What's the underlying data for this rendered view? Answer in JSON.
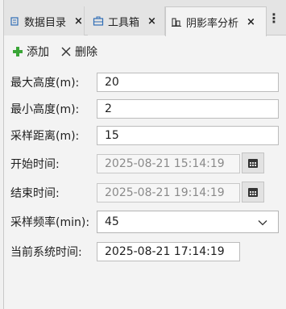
{
  "tabs": [
    {
      "label": "数据目录",
      "close": "×",
      "icon": "data-catalog-icon"
    },
    {
      "label": "工具箱",
      "close": "×",
      "icon": "toolbox-icon"
    },
    {
      "label": "阴影率分析",
      "close": "×",
      "icon": "shadow-analysis-icon"
    }
  ],
  "menu": {
    "dots": "⋮"
  },
  "toolbar": {
    "add_label": "添加",
    "delete_label": "删除"
  },
  "form": {
    "max_height": {
      "label": "最大高度(m):",
      "value": "20"
    },
    "min_height": {
      "label": "最小高度(m):",
      "value": "2"
    },
    "sample_distance": {
      "label": "采样距离(m):",
      "value": "15"
    },
    "start_time": {
      "label": "开始时间:",
      "value": "2025-08-21 15:14:19"
    },
    "end_time": {
      "label": "结束时间:",
      "value": "2025-08-21 19:14:19"
    },
    "sample_frequency": {
      "label": "采样频率(min):",
      "value": "45"
    },
    "current_time": {
      "label": "当前系统时间:",
      "value": "2025-08-21 17:14:19"
    }
  },
  "colors": {
    "add_icon": "#3aa537",
    "accent": "#2f6db5"
  }
}
